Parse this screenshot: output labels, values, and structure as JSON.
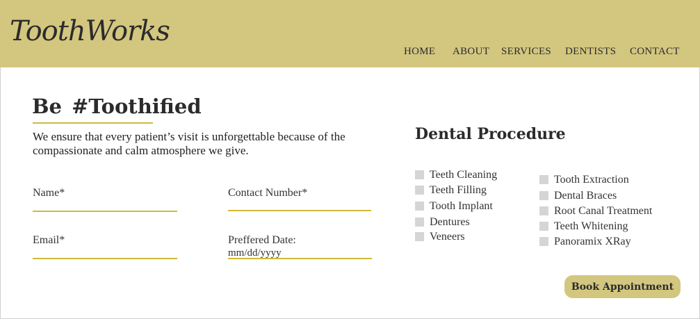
{
  "brand": {
    "logo_text": "ToothWorks"
  },
  "nav": {
    "items": [
      "HOME",
      "ABOUT",
      "SERVICES",
      "DENTISTS",
      "CONTACT"
    ]
  },
  "hero": {
    "title": "Be #Toothified",
    "intro": "We ensure that every patient’s visit is unforgettable because of the compassionate and calm atmosphere we give."
  },
  "form": {
    "name_label": "Name*",
    "contact_label": "Contact Number*",
    "email_label": "Email*",
    "date_label": "Preffered Date:",
    "date_placeholder": "mm/dd/yyyy"
  },
  "procedures": {
    "title": "Dental Procedure",
    "left": [
      "Teeth Cleaning",
      "Teeth Filling",
      "Tooth Implant",
      "Dentures",
      "Veneers"
    ],
    "right": [
      "Tooth Extraction",
      "Dental Braces",
      "Root Canal Treatment",
      "Teeth Whitening",
      "Panoramix XRay"
    ]
  },
  "cta": {
    "book_label": "Book Appointment"
  },
  "colors": {
    "header_bg": "#d3c67f",
    "accent_line": "#d1b93a",
    "checkbox": "#d5d5d5"
  }
}
